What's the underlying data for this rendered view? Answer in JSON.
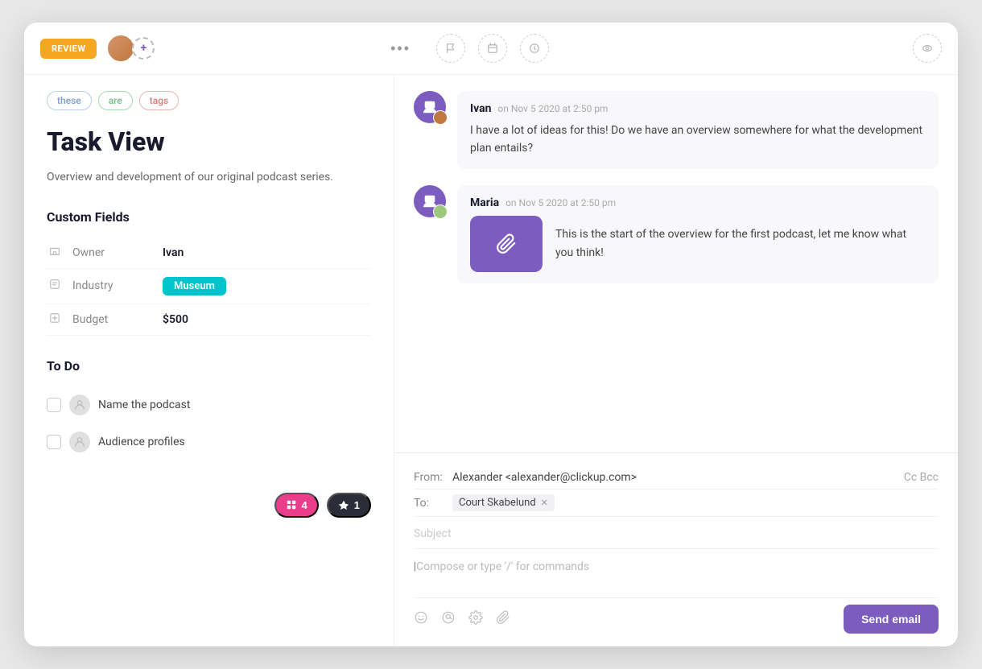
{
  "toolbar": {
    "review_label": "REVIEW",
    "more_icon": "•••",
    "icons": {
      "flag": "flag",
      "calendar": "calendar",
      "clock": "clock",
      "eye": "eye"
    }
  },
  "tags": [
    {
      "label": "these",
      "color": "blue"
    },
    {
      "label": "are",
      "color": "green"
    },
    {
      "label": "tags",
      "color": "red"
    }
  ],
  "task": {
    "title": "Task View",
    "description": "Overview and development of our original podcast series."
  },
  "custom_fields": {
    "section_title": "Custom Fields",
    "fields": [
      {
        "icon": "lines",
        "name": "Owner",
        "value": "Ivan",
        "type": "text"
      },
      {
        "icon": "box",
        "name": "Industry",
        "value": "Museum",
        "type": "badge"
      },
      {
        "icon": "box2",
        "name": "Budget",
        "value": "$500",
        "type": "text"
      }
    ]
  },
  "todo": {
    "section_title": "To Do",
    "items": [
      {
        "label": "Name the podcast",
        "checked": false
      },
      {
        "label": "Audience profiles",
        "checked": false
      }
    ]
  },
  "bottom_badges": [
    {
      "count": "4",
      "color": "pink",
      "icon": "grid"
    },
    {
      "count": "1",
      "color": "dark",
      "icon": "figma"
    }
  ],
  "comments": [
    {
      "author": "Ivan",
      "timestamp": "on Nov 5 2020 at 2:50 pm",
      "text": "I have a lot of ideas for this! Do we have an overview somewhere for what the development plan entails?",
      "has_attachment": false
    },
    {
      "author": "Maria",
      "timestamp": "on Nov 5 2020 at 2:50 pm",
      "text": "This is the start of the overview for the first podcast, let me know what you think!",
      "has_attachment": true
    }
  ],
  "email": {
    "from_label": "From:",
    "from_value": "Alexander <alexander@clickup.com>",
    "cc_bcc": "Cc  Bcc",
    "to_label": "To:",
    "to_recipient": "Court Skabelund",
    "subject_placeholder": "Subject",
    "compose_placeholder": "Compose or type '/' for commands",
    "send_button": "Send email"
  }
}
